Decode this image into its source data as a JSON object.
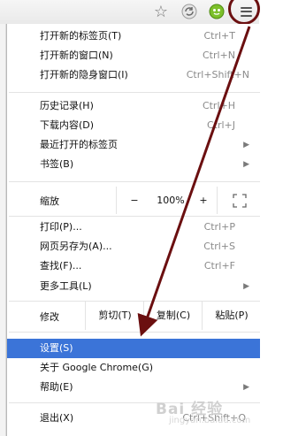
{
  "toolbar": {
    "icons": [
      "star-icon",
      "refresh-icon",
      "extension-icon",
      "menu-icon"
    ]
  },
  "menu": {
    "groups": [
      [
        {
          "label": "打开新的标签页(T)",
          "shortcut": "Ctrl+T"
        },
        {
          "label": "打开新的窗口(N)",
          "shortcut": "Ctrl+N"
        },
        {
          "label": "打开新的隐身窗口(I)",
          "shortcut": "Ctrl+Shift+N"
        }
      ],
      [
        {
          "label": "历史记录(H)",
          "shortcut": "Ctrl+H"
        },
        {
          "label": "下载内容(D)",
          "shortcut": "Ctrl+J"
        },
        {
          "label": "最近打开的标签页",
          "shortcut": ""
        },
        {
          "label": "书签(B)",
          "shortcut": ""
        }
      ]
    ],
    "zoom": {
      "label": "缩放",
      "minus": "−",
      "value": "100%",
      "plus": "+",
      "fullscreen_icon": "fullscreen-icon"
    },
    "group3": [
      {
        "label": "打印(P)...",
        "shortcut": "Ctrl+P"
      },
      {
        "label": "网页另存为(A)...",
        "shortcut": "Ctrl+S"
      },
      {
        "label": "查找(F)...",
        "shortcut": "Ctrl+F"
      },
      {
        "label": "更多工具(L)",
        "shortcut": ""
      }
    ],
    "edit": {
      "label": "修改",
      "cut": "剪切(T)",
      "copy": "复制(C)",
      "paste": "粘贴(P)"
    },
    "group4": [
      {
        "label": "设置(S)",
        "selected": true
      },
      {
        "label": "关于 Google Chrome(G)"
      },
      {
        "label": "帮助(E)"
      }
    ],
    "exit": {
      "label": "退出(X)",
      "shortcut": "Ctrl+Shift+Q"
    }
  },
  "watermark": {
    "text": "Bai 经验",
    "sub": "jingyan.baidu.com"
  },
  "colors": {
    "accent": "#3b74d8",
    "annotation": "#6b0f10"
  }
}
